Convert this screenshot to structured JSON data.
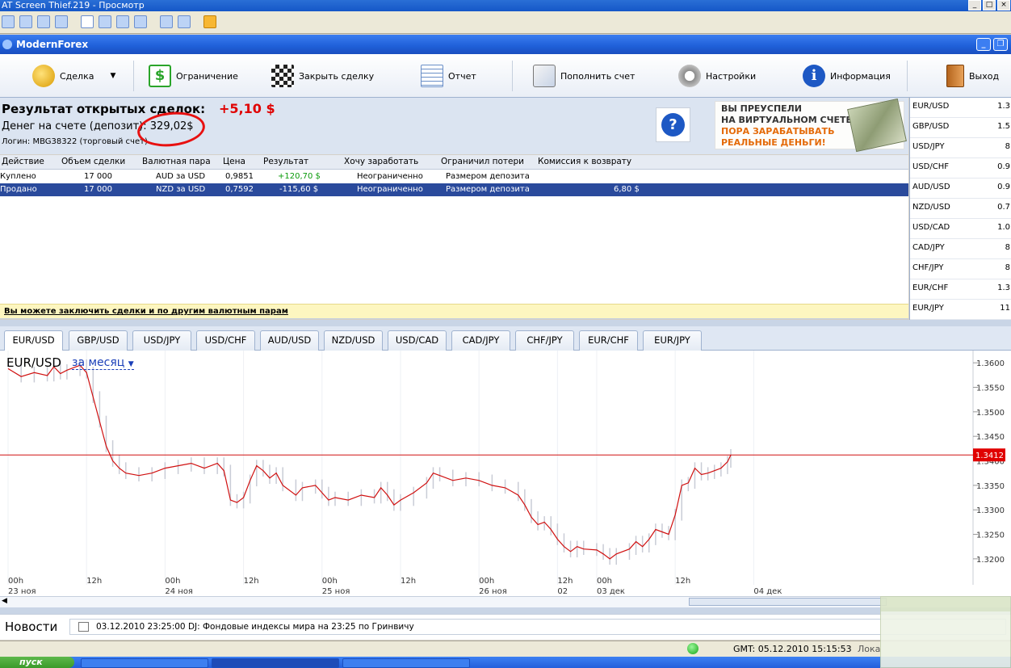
{
  "snip_window": {
    "title": "AT Screen Thief",
    "title_suffix": ".219 - Просмотр"
  },
  "app": {
    "title": "ModernForex"
  },
  "toolbar": {
    "deal": "Сделка",
    "limit": "Ограничение",
    "close_deal": "Закрыть сделку",
    "report": "Отчет",
    "deposit": "Пополнить счет",
    "settings": "Настройки",
    "info": "Информация",
    "exit": "Выход"
  },
  "summary": {
    "result_label": "Результат открытых сделок:",
    "result_value": "+5,10 $",
    "money_label": "Денег на счете (депозит):",
    "money_value": "329,02$",
    "login": "Логин: MBG38322 (торговый счет)"
  },
  "banner": {
    "line1": "ВЫ ПРЕУСПЕЛИ",
    "line2": "НА ВИРТУАЛЬНОМ СЧЕТЕ.",
    "line3": "ПОРА ЗАРАБАТЫВАТЬ",
    "line4": "РЕАЛЬНЫЕ ДЕНЬГИ!"
  },
  "table": {
    "headers": [
      "Действие",
      "Объем сделки",
      "Валютная пара",
      "Цена",
      "Результат",
      "Хочу заработать",
      "Ограничил потери",
      "Комиссия к возврату"
    ],
    "rows": [
      {
        "action": "Куплено",
        "volume": "17 000",
        "pair": "AUD за USD",
        "price": "0,9851",
        "result": "+120,70 $",
        "take": "Неограниченно",
        "stop": "Размером депозита",
        "commission": ""
      },
      {
        "action": "Продано",
        "volume": "17 000",
        "pair": "NZD за USD",
        "price": "0,7592",
        "result": "-115,60 $",
        "take": "Неограниченно",
        "stop": "Размером депозита",
        "commission": "6,80 $"
      }
    ]
  },
  "notice": "Вы можете заключить сделки и по другим валютным парам",
  "quotes": [
    {
      "pair": "EUR/USD",
      "value": "1.3"
    },
    {
      "pair": "GBP/USD",
      "value": "1.5"
    },
    {
      "pair": "USD/JPY",
      "value": "8"
    },
    {
      "pair": "USD/CHF",
      "value": "0.9"
    },
    {
      "pair": "AUD/USD",
      "value": "0.9"
    },
    {
      "pair": "NZD/USD",
      "value": "0.7"
    },
    {
      "pair": "USD/CAD",
      "value": "1.0"
    },
    {
      "pair": "CAD/JPY",
      "value": "8"
    },
    {
      "pair": "CHF/JPY",
      "value": "8"
    },
    {
      "pair": "EUR/CHF",
      "value": "1.3"
    },
    {
      "pair": "EUR/JPY",
      "value": "11"
    }
  ],
  "tabs": [
    "EUR/USD",
    "GBP/USD",
    "USD/JPY",
    "USD/CHF",
    "AUD/USD",
    "NZD/USD",
    "USD/CAD",
    "CAD/JPY",
    "CHF/JPY",
    "EUR/CHF",
    "EUR/JPY"
  ],
  "chart_header": {
    "pair": "EUR/USD",
    "period": "за месяц"
  },
  "chart_data": {
    "type": "line",
    "title": "EUR/USD",
    "current_price": "1.3412",
    "current_price_value": 1.3412,
    "ylim": [
      1.318,
      1.3625
    ],
    "y_ticks": [
      "1.3600",
      "1.3550",
      "1.3500",
      "1.3450",
      "1.3400",
      "1.3350",
      "1.3300",
      "1.3250",
      "1.3200"
    ],
    "x_tick_labels": [
      {
        "time": "00h",
        "date": "23 ноя"
      },
      {
        "time": "12h",
        "date": ""
      },
      {
        "time": "00h",
        "date": "24 ноя"
      },
      {
        "time": "12h",
        "date": ""
      },
      {
        "time": "00h",
        "date": "25 ноя"
      },
      {
        "time": "12h",
        "date": ""
      },
      {
        "time": "00h",
        "date": "26 ноя"
      },
      {
        "time": "12h",
        "date": "02"
      },
      {
        "time": "00h",
        "date": "03 дек"
      },
      {
        "time": "12h",
        "date": ""
      },
      {
        "time": "",
        "date": "04 дек"
      }
    ],
    "x_tick_units": [
      0,
      12,
      24,
      36,
      48,
      60,
      72,
      84,
      90,
      102,
      114
    ],
    "series": [
      {
        "values": [
          [
            0,
            1.3588
          ],
          [
            2,
            1.3572
          ],
          [
            4,
            1.358
          ],
          [
            6,
            1.3574
          ],
          [
            7,
            1.3592
          ],
          [
            8,
            1.3578
          ],
          [
            9,
            1.3585
          ],
          [
            11,
            1.3595
          ],
          [
            12,
            1.358
          ],
          [
            13,
            1.353
          ],
          [
            14,
            1.348
          ],
          [
            15,
            1.343
          ],
          [
            16,
            1.34
          ],
          [
            17,
            1.3385
          ],
          [
            18,
            1.3375
          ],
          [
            20,
            1.337
          ],
          [
            22,
            1.3375
          ],
          [
            24,
            1.3385
          ],
          [
            26,
            1.339
          ],
          [
            28,
            1.3395
          ],
          [
            30,
            1.3385
          ],
          [
            32,
            1.3395
          ],
          [
            33,
            1.338
          ],
          [
            34,
            1.332
          ],
          [
            35,
            1.3315
          ],
          [
            36,
            1.3325
          ],
          [
            37,
            1.336
          ],
          [
            38,
            1.339
          ],
          [
            39,
            1.338
          ],
          [
            40,
            1.3365
          ],
          [
            41,
            1.3375
          ],
          [
            42,
            1.335
          ],
          [
            44,
            1.333
          ],
          [
            45,
            1.3345
          ],
          [
            47,
            1.335
          ],
          [
            48,
            1.3335
          ],
          [
            49,
            1.332
          ],
          [
            50,
            1.3325
          ],
          [
            52,
            1.332
          ],
          [
            54,
            1.333
          ],
          [
            56,
            1.3325
          ],
          [
            57,
            1.3345
          ],
          [
            58,
            1.333
          ],
          [
            59,
            1.331
          ],
          [
            60,
            1.332
          ],
          [
            62,
            1.3335
          ],
          [
            64,
            1.3355
          ],
          [
            65,
            1.3375
          ],
          [
            66,
            1.337
          ],
          [
            68,
            1.336
          ],
          [
            70,
            1.3365
          ],
          [
            72,
            1.336
          ],
          [
            74,
            1.335
          ],
          [
            76,
            1.3345
          ],
          [
            78,
            1.333
          ],
          [
            79,
            1.331
          ],
          [
            80,
            1.3285
          ],
          [
            81,
            1.327
          ],
          [
            82,
            1.3275
          ],
          [
            83,
            1.326
          ],
          [
            84,
            1.324
          ],
          [
            85,
            1.3225
          ],
          [
            86,
            1.3215
          ],
          [
            87,
            1.3225
          ],
          [
            88,
            1.322
          ],
          [
            90,
            1.3218
          ],
          [
            91,
            1.321
          ],
          [
            92,
            1.32
          ],
          [
            93,
            1.321
          ],
          [
            95,
            1.322
          ],
          [
            96,
            1.3235
          ],
          [
            97,
            1.3225
          ],
          [
            98,
            1.324
          ],
          [
            99,
            1.326
          ],
          [
            100,
            1.3255
          ],
          [
            101,
            1.325
          ],
          [
            102,
            1.329
          ],
          [
            103,
            1.335
          ],
          [
            104,
            1.3355
          ],
          [
            105,
            1.3385
          ],
          [
            106,
            1.3372
          ],
          [
            107,
            1.3375
          ],
          [
            108,
            1.338
          ],
          [
            109,
            1.3385
          ],
          [
            110,
            1.3398
          ],
          [
            110.5,
            1.3412
          ]
        ]
      }
    ]
  },
  "news": {
    "label": "Новости",
    "item": "03.12.2010 23:25:00  DJ: Фондовые индексы мира на 23:25 по Гринвичу"
  },
  "status": {
    "gmt": "GMT:  05.12.2010 15:15:53",
    "extra": "Лока"
  },
  "taskbar": {
    "start": "пуск"
  }
}
